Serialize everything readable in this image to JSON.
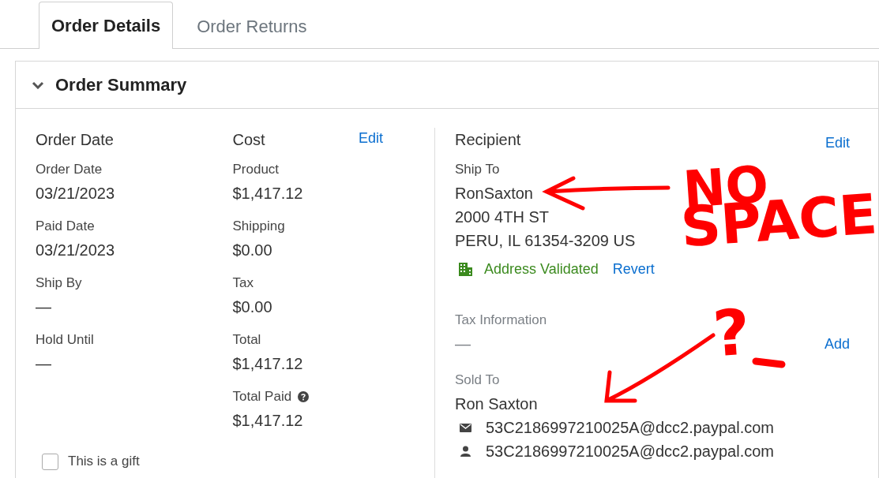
{
  "tabs": [
    {
      "label": "Order Details",
      "selected": true
    },
    {
      "label": "Order Returns",
      "selected": false
    }
  ],
  "panel": {
    "title": "Order Summary",
    "expanded": true
  },
  "columns": [
    {
      "heading": "Order Date",
      "fields": [
        {
          "label": "Order Date",
          "value": "03/21/2023"
        },
        {
          "label": "Paid Date",
          "value": "03/21/2023"
        },
        {
          "label": "Ship By",
          "value": "—"
        },
        {
          "label": "Hold Until",
          "value": "—"
        }
      ]
    },
    {
      "heading": "Cost",
      "edit": "Edit",
      "fields": [
        {
          "label": "Product",
          "value": "$1,417.12"
        },
        {
          "label": "Shipping",
          "value": "$0.00"
        },
        {
          "label": "Tax",
          "value": "$0.00"
        },
        {
          "label": "Total",
          "value": "$1,417.12"
        },
        {
          "label": "Total Paid",
          "value": "$1,417.12",
          "help": true
        }
      ]
    }
  ],
  "gift": {
    "label": "This is a gift",
    "checked": false
  },
  "recipient": {
    "heading": "Recipient",
    "edit": "Edit",
    "ship_to_label": "Ship To",
    "address": [
      "RonSaxton",
      "2000 4TH ST",
      "PERU, IL 61354-3209 US"
    ],
    "validation": {
      "text": "Address Validated",
      "validated": true,
      "action": "Revert"
    },
    "tax": {
      "label": "Tax Information",
      "value": "—",
      "action": "Add"
    },
    "sold_to": {
      "label": "Sold To",
      "name": "Ron Saxton",
      "contacts": [
        {
          "kind": "email",
          "text": "53C2186997210025A@dcc2.paypal.com"
        },
        {
          "kind": "user",
          "text": "53C2186997210025A@dcc2.paypal.com"
        }
      ]
    }
  },
  "annotations": [
    {
      "kind": "arrow"
    },
    {
      "kind": "text",
      "text": "NO"
    },
    {
      "kind": "text",
      "text": "SPACE"
    },
    {
      "kind": "text",
      "text": "?"
    },
    {
      "kind": "dash"
    },
    {
      "kind": "arrow"
    }
  ]
}
